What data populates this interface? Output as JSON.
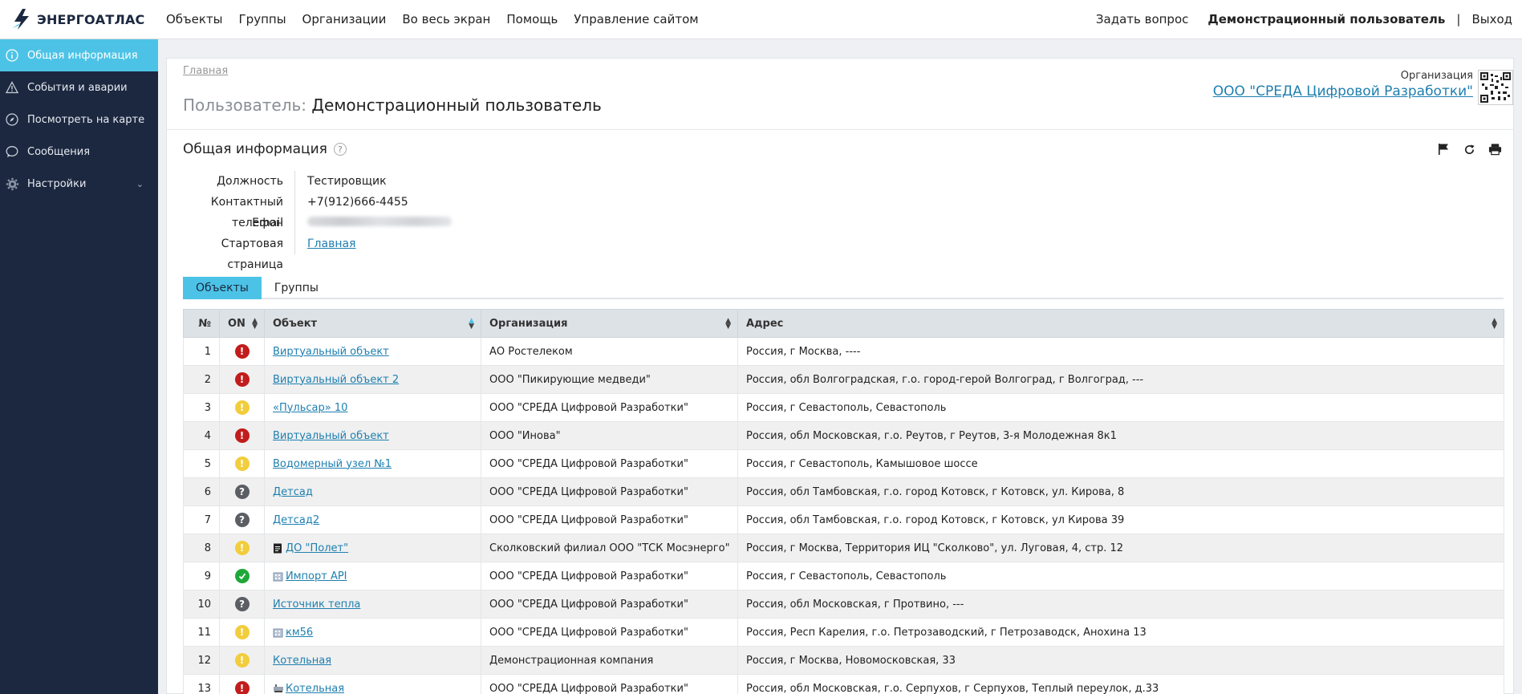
{
  "app": {
    "logo_text": "ЭНЕРГОАТЛАС",
    "accent": "#4cc3e6",
    "sidebar_bg": "#1c2840"
  },
  "nav": [
    "Объекты",
    "Группы",
    "Организации",
    "Во весь экран",
    "Помощь",
    "Управление сайтом"
  ],
  "top_right": {
    "ask": "Задать вопрос",
    "user": "Демонстрационный пользователь",
    "separator": "|",
    "logout": "Выход"
  },
  "sidebar": {
    "items": [
      {
        "label": "Общая информация",
        "icon": "info-icon",
        "active": true
      },
      {
        "label": "События и аварии",
        "icon": "warning-icon",
        "active": false
      },
      {
        "label": "Посмотреть на карте",
        "icon": "compass-icon",
        "active": false
      },
      {
        "label": "Сообщения",
        "icon": "chat-icon",
        "active": false
      },
      {
        "label": "Настройки",
        "icon": "gear-icon",
        "active": false,
        "expandable": true
      }
    ]
  },
  "breadcrumb": "Главная",
  "page": {
    "title_prefix": "Пользователь:",
    "title_name": "Демонстрационный пользователь"
  },
  "organization": {
    "label": "Организация",
    "name": "ООО \"СРЕДА Цифровой Разработки\""
  },
  "section": {
    "title": "Общая информация",
    "help": "?"
  },
  "info": {
    "position_label": "Должность",
    "position_value": "Тестировщик",
    "phone_label": "Контактный телефон",
    "phone_value": "+7(912)666-4455",
    "email_label": "Email",
    "start_label": "Стартовая страница",
    "start_value": "Главная"
  },
  "tabs": [
    "Объекты",
    "Группы"
  ],
  "table": {
    "headers": {
      "num": "№",
      "on": "ON",
      "object": "Объект",
      "org": "Организация",
      "address": "Адрес"
    },
    "status_colors": {
      "alarm": "#c21c1c",
      "warn": "#f2cd3c",
      "unknown": "#5b5e63",
      "ok": "#1fa83a"
    },
    "rows": [
      {
        "n": "1",
        "status": "alarm",
        "object": "Виртуальный объект",
        "icon": "",
        "org": "АО Ростелеком",
        "address": "Россия, г Москва, ----"
      },
      {
        "n": "2",
        "status": "alarm",
        "object": "Виртуальный объект 2",
        "icon": "",
        "org": "ООО \"Пикирующие медведи\"",
        "address": "Россия, обл Волгоградская, г.о. город-герой Волгоград, г Волгоград, ---"
      },
      {
        "n": "3",
        "status": "warn",
        "object": "«Пульсар» 10",
        "icon": "",
        "org": "ООО \"СРЕДА Цифровой Разработки\"",
        "address": "Россия, г Севастополь, Севастополь"
      },
      {
        "n": "4",
        "status": "alarm",
        "object": "Виртуальный объект",
        "icon": "",
        "org": "ООО \"Инова\"",
        "address": "Россия, обл Московская, г.о. Реутов, г Реутов, 3-я Молодежная 8к1"
      },
      {
        "n": "5",
        "status": "warn",
        "object": "Водомерный узел №1",
        "icon": "",
        "org": "ООО \"СРЕДА Цифровой Разработки\"",
        "address": "Россия, г Севастополь, Камышовое шоссе"
      },
      {
        "n": "6",
        "status": "unknown",
        "object": "Детсад",
        "icon": "",
        "org": "ООО \"СРЕДА Цифровой Разработки\"",
        "address": "Россия, обл Тамбовская, г.о. город Котовск, г Котовск, ул. Кирова, 8"
      },
      {
        "n": "7",
        "status": "unknown",
        "object": "Детсад2",
        "icon": "",
        "org": "ООО \"СРЕДА Цифровой Разработки\"",
        "address": "Россия, обл Тамбовская, г.о. город Котовск, г Котовск, ул Кирова 39"
      },
      {
        "n": "8",
        "status": "warn",
        "object": "ДО \"Полет\"",
        "icon": "document-icon",
        "org": "Сколковский филиал ООО \"ТСК Мосэнерго\"",
        "address": "Россия, г Москва, Территория ИЦ \"Сколково\", ул. Луговая, 4, стр. 12"
      },
      {
        "n": "9",
        "status": "ok",
        "object": "Импорт API",
        "icon": "building-icon",
        "org": "ООО \"СРЕДА Цифровой Разработки\"",
        "address": "Россия, г Севастополь, Севастополь"
      },
      {
        "n": "10",
        "status": "unknown",
        "object": "Источник тепла",
        "icon": "",
        "org": "ООО \"СРЕДА Цифровой Разработки\"",
        "address": "Россия, обл Московская, г Протвино, ---"
      },
      {
        "n": "11",
        "status": "warn",
        "object": "км56",
        "icon": "building-icon",
        "org": "ООО \"СРЕДА Цифровой Разработки\"",
        "address": "Россия, Респ Карелия, г.о. Петрозаводский, г Петрозаводск, Анохина 13"
      },
      {
        "n": "12",
        "status": "warn",
        "object": "Котельная",
        "icon": "",
        "org": "Демонстрационная компания",
        "address": "Россия, г Москва, Новомосковская, 33"
      },
      {
        "n": "13",
        "status": "alarm",
        "object": "Котельная",
        "icon": "boiler-icon",
        "org": "ООО \"СРЕДА Цифровой Разработки\"",
        "address": "Россия, обл Московская, г.о. Серпухов, г Серпухов, Теплый переулок, д.33"
      }
    ]
  }
}
